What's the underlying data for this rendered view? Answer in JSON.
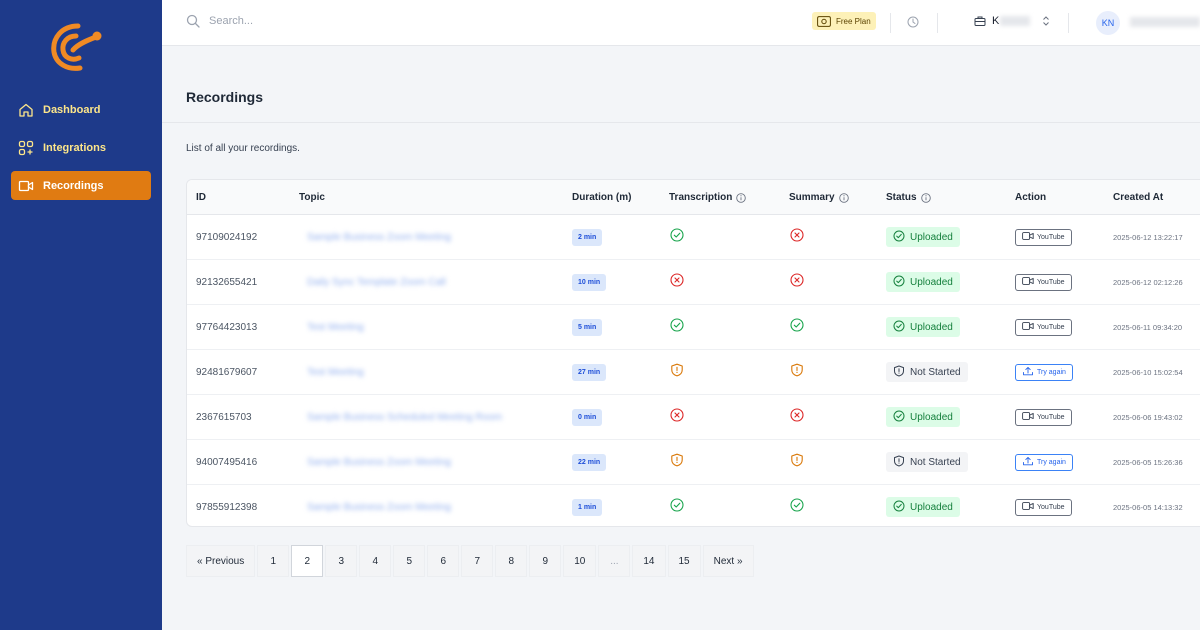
{
  "sidebar": {
    "items": [
      {
        "label": "Dashboard",
        "icon": "home-icon"
      },
      {
        "label": "Integrations",
        "icon": "grid-plus-icon"
      },
      {
        "label": "Recordings",
        "icon": "video-icon",
        "active": true
      }
    ],
    "colors": {
      "background": "#1e3a8a",
      "active": "#e07b12",
      "text": "#fde68a"
    }
  },
  "topbar": {
    "search_placeholder": "Search...",
    "plan_badge": "Free Plan",
    "workspace_initial": "K",
    "avatar_initials": "KN"
  },
  "page": {
    "title": "Recordings",
    "subtitle": "List of all your recordings."
  },
  "table": {
    "headers": {
      "id": "ID",
      "topic": "Topic",
      "duration": "Duration (m)",
      "transcription": "Transcription",
      "summary": "Summary",
      "status": "Status",
      "action": "Action",
      "created": "Created At"
    },
    "rows": [
      {
        "id": "97109024192",
        "topic": "Sample Business Zoom Meeting",
        "duration": "2 min",
        "transcription": "success",
        "summary": "failed",
        "status": "Uploaded",
        "status_type": "uploaded",
        "action": "YouTube",
        "action_type": "youtube",
        "created": "2025-06-12 13:22:17"
      },
      {
        "id": "92132655421",
        "topic": "Daily Sync Template Zoom Call",
        "duration": "10 min",
        "transcription": "failed",
        "summary": "failed",
        "status": "Uploaded",
        "status_type": "uploaded",
        "action": "YouTube",
        "action_type": "youtube",
        "created": "2025-06-12 02:12:26"
      },
      {
        "id": "97764423013",
        "topic": "Test Meeting",
        "duration": "5 min",
        "transcription": "success",
        "summary": "success",
        "status": "Uploaded",
        "status_type": "uploaded",
        "action": "YouTube",
        "action_type": "youtube",
        "created": "2025-06-11 09:34:20"
      },
      {
        "id": "92481679607",
        "topic": "Test Meeting",
        "duration": "27 min",
        "transcription": "warning",
        "summary": "warning",
        "status": "Not Started",
        "status_type": "notstarted",
        "action": "Try again",
        "action_type": "retry",
        "created": "2025-06-10 15:02:54"
      },
      {
        "id": "2367615703",
        "topic": "Sample Business Scheduled Meeting Room",
        "duration": "0 min",
        "transcription": "failed",
        "summary": "failed",
        "status": "Uploaded",
        "status_type": "uploaded",
        "action": "YouTube",
        "action_type": "youtube",
        "created": "2025-06-06 19:43:02"
      },
      {
        "id": "94007495416",
        "topic": "Sample Business Zoom Meeting",
        "duration": "22 min",
        "transcription": "warning",
        "summary": "warning",
        "status": "Not Started",
        "status_type": "notstarted",
        "action": "Try again",
        "action_type": "retry",
        "created": "2025-06-05 15:26:36"
      },
      {
        "id": "97855912398",
        "topic": "Sample Business Zoom Meeting",
        "duration": "1 min",
        "transcription": "success",
        "summary": "success",
        "status": "Uploaded",
        "status_type": "uploaded",
        "action": "YouTube",
        "action_type": "youtube",
        "created": "2025-06-05 14:13:32"
      }
    ]
  },
  "pagination": {
    "items": [
      "« Previous",
      "1",
      "2",
      "3",
      "4",
      "5",
      "6",
      "7",
      "8",
      "9",
      "10",
      "...",
      "14",
      "15",
      "Next »"
    ],
    "current": "2"
  }
}
